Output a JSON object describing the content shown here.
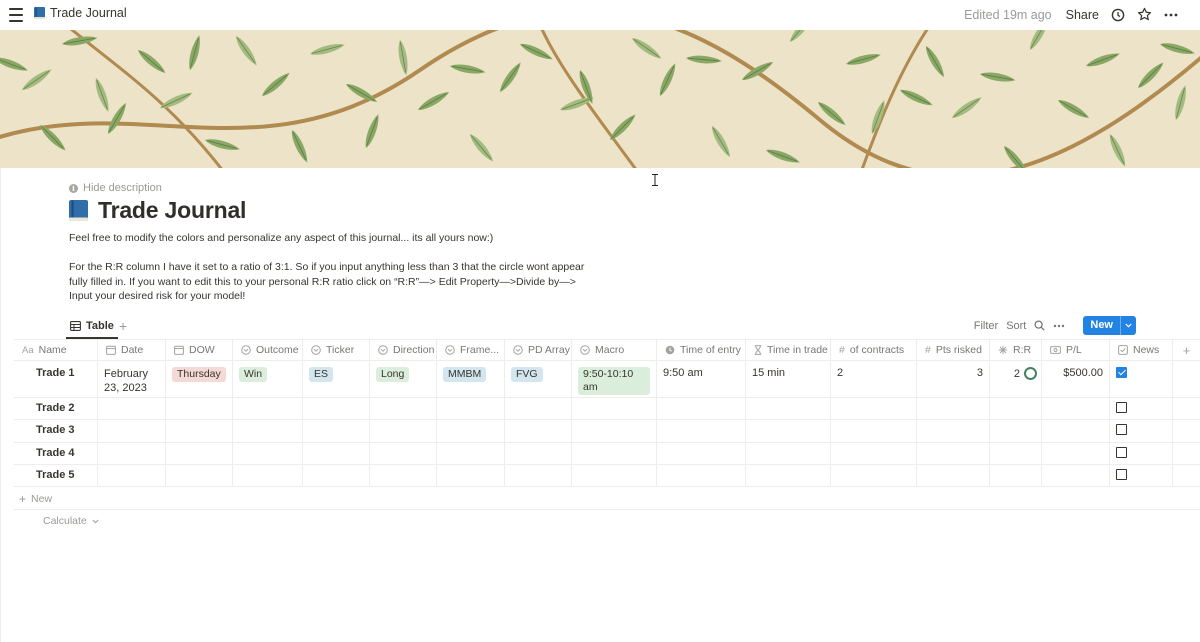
{
  "topbar": {
    "page_title": "Trade Journal",
    "edited": "Edited 19m ago",
    "share": "Share"
  },
  "header": {
    "hide_description": "Hide description",
    "title": "Trade Journal",
    "description": [
      "Feel free to modify the colors and personalize any aspect of this journal... its all yours now:)",
      "For the R:R column I have it set to a ratio of 3:1. So if you input anything less than 3 that the circle wont appear fully filled in. If you want to edit this to your personal R:R ratio click on “R:R”—> Edit Property—>Divide by—> Input your desired risk for your model!"
    ]
  },
  "view": {
    "tab_label": "Table",
    "filter": "Filter",
    "sort": "Sort",
    "new_label": "New"
  },
  "columns": [
    "Name",
    "Date",
    "DOW",
    "Outcome",
    "Ticker",
    "Direction",
    "Frame...",
    "PD Array",
    "Macro",
    "Time of entry",
    "Time in trade",
    "of contracts",
    "Pts risked",
    "R:R",
    "P/L",
    "News"
  ],
  "rows": [
    {
      "name": "Trade 1",
      "date": "February 23, 2023",
      "dow": "Thursday",
      "outcome": "Win",
      "ticker": "ES",
      "direction": "Long",
      "frame": "MMBM",
      "pd_array": "FVG",
      "macro": "9:50-10:10 am",
      "time_of_entry": "9:50 am",
      "time_in_trade": "15 min",
      "contracts": "2",
      "pts_risked": "3",
      "rr": "2",
      "rr_fill": 0.67,
      "pl": "$500.00",
      "news": true
    },
    {
      "name": "Trade 2",
      "news": false
    },
    {
      "name": "Trade 3",
      "news": false
    },
    {
      "name": "Trade 4",
      "news": false
    },
    {
      "name": "Trade 5",
      "news": false
    }
  ],
  "tag_colors": {
    "dow": "#f4d9d4",
    "outcome": "#dbeddb",
    "ticker": "#d3e5ef",
    "direction": "#dbeddb",
    "frame": "#d3e5ef",
    "pd_array": "#d3e5ef",
    "macro": "#dbeddb"
  },
  "footer": {
    "new_row": "New",
    "calculate": "Calculate"
  }
}
